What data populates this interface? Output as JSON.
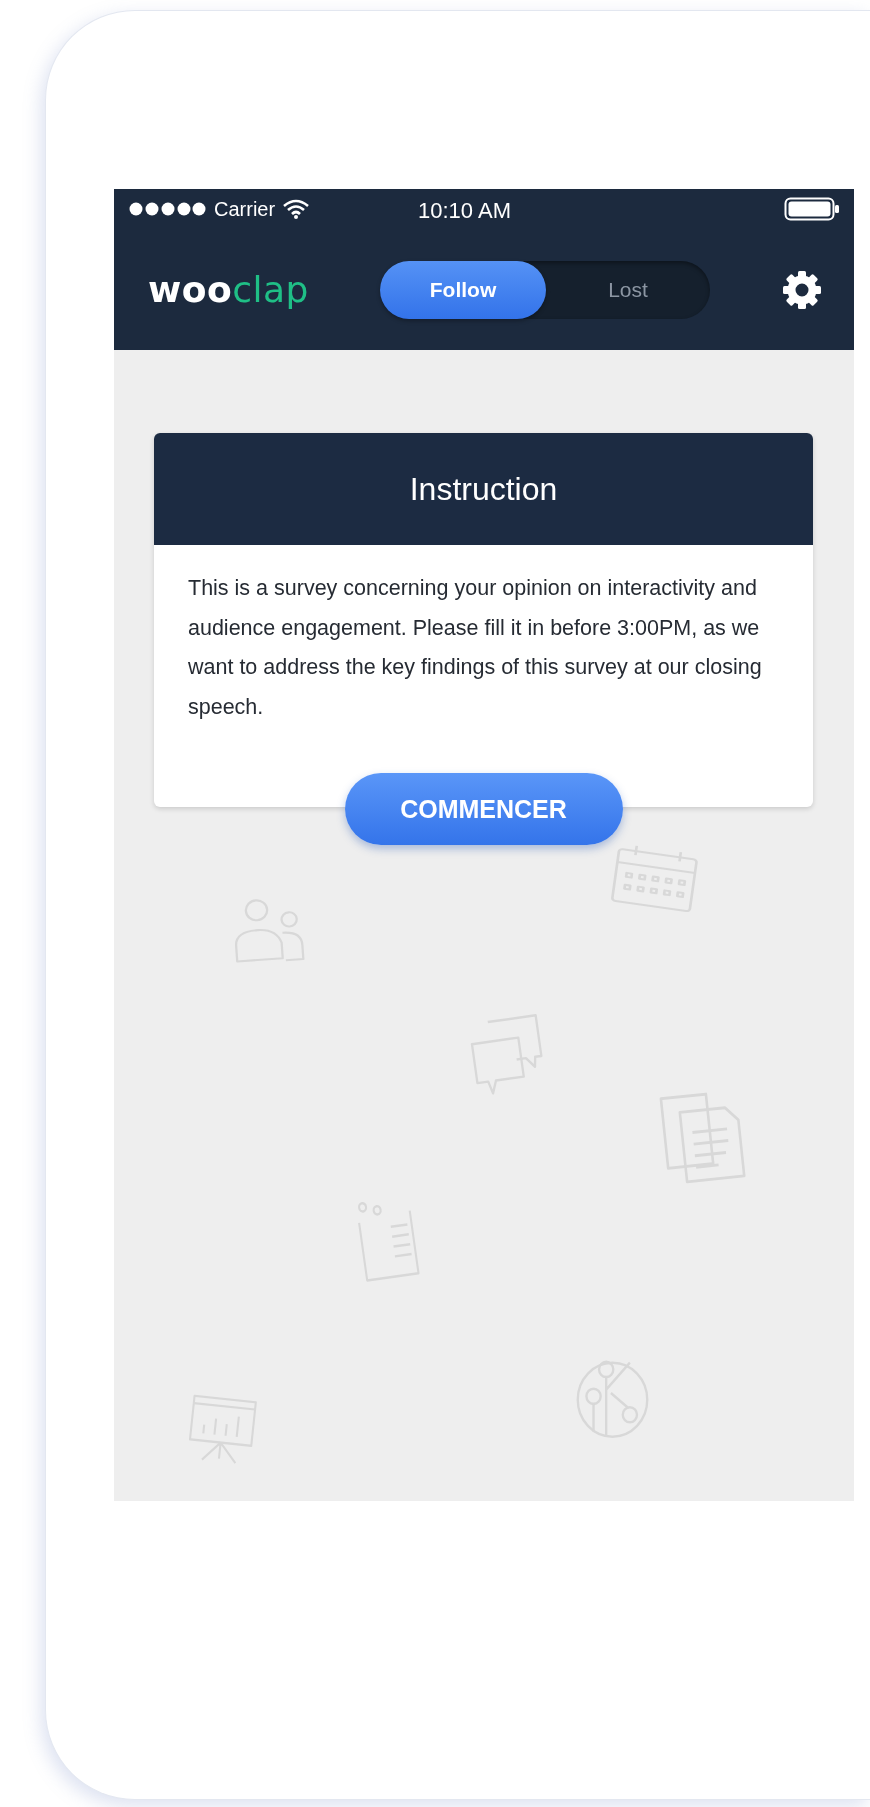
{
  "status_bar": {
    "carrier": "Carrier",
    "time": "10:10 AM"
  },
  "nav": {
    "logo": [
      "woo",
      "clap"
    ],
    "tabs": [
      {
        "label": "Follow",
        "selected": true
      },
      {
        "label": "Lost",
        "selected": false
      }
    ]
  },
  "card": {
    "title": "Instruction",
    "text": "This is a survey concerning your opinion on interactivity and audience engagement. Please fill it in before 3:00PM, as we want to address the key findings of this survey at our closing speech.",
    "button": "COMMENCER"
  }
}
